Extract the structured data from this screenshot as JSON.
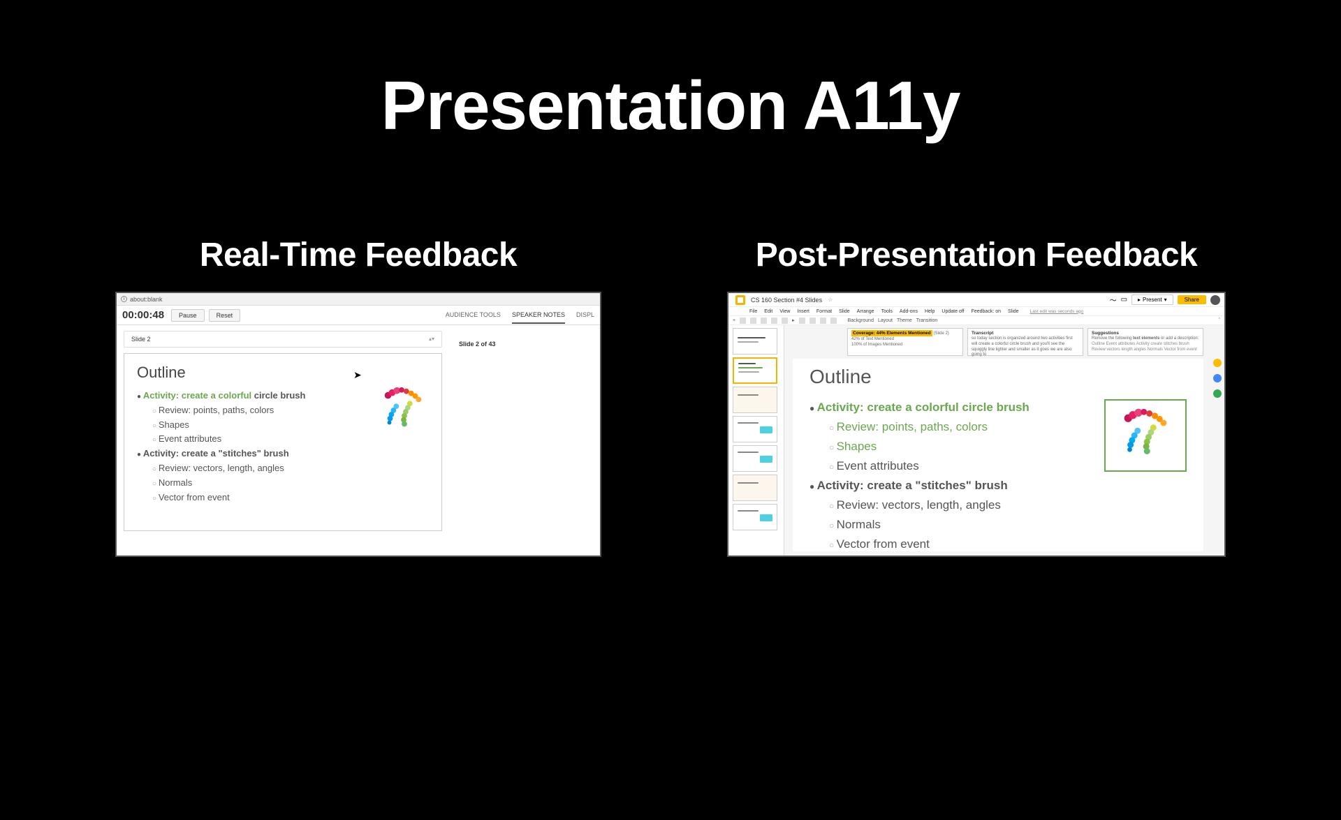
{
  "title": "Presentation A11y",
  "left": {
    "heading": "Real-Time Feedback",
    "url": "about:blank",
    "timer": "00:00:48",
    "pause": "Pause",
    "reset": "Reset",
    "tabs": {
      "audience": "AUDIENCE TOOLS",
      "speaker": "SPEAKER NOTES",
      "display": "DISPL"
    },
    "slide_sel": "Slide 2",
    "slide_of": "Slide 2 of 43",
    "outline": {
      "title": "Outline",
      "a1_hl": "Activity: create a colorful",
      "a1_rest": " circle brush",
      "s1": "Review: points, paths, colors",
      "s2": "Shapes",
      "s3": "Event attributes",
      "a2": "Activity: create a \"stitches\" brush",
      "s4": "Review: vectors, length, angles",
      "s5": "Normals",
      "s6": "Vector from event"
    }
  },
  "right": {
    "heading": "Post-Presentation Feedback",
    "doc_title": "CS 160 Section #4 Slides",
    "menus": [
      "File",
      "Edit",
      "View",
      "Insert",
      "Format",
      "Slide",
      "Arrange",
      "Tools",
      "Add-ons",
      "Help",
      "Update off",
      "Feedback: on",
      "Slide"
    ],
    "last_edit": "Last edit was seconds ago",
    "present": "Present",
    "share": "Share",
    "toolbar_labels": [
      "Background",
      "Layout",
      "Theme",
      "Transition"
    ],
    "coverage": {
      "head": "Coverage: 44% Elements Mentioned",
      "slide": "(Slide 2)",
      "l1": "42% of Text Mentioned",
      "l2": "100% of Images Mentioned"
    },
    "transcript": {
      "head": "Transcript",
      "body": "so today section is organized around two activities first will create a colorful circle brush and you'll see the squiggly line lighter and smaller as it goes we are also going to"
    },
    "suggest": {
      "head": "Suggestions",
      "b1": "Remove the following ",
      "b1b": "text elements",
      "b2": " or add a description: ",
      "b3": "Outline Event attributes Activity create stitches brush Review vectors length angles Normals Vector from event"
    },
    "outline2": {
      "title": "Outline",
      "a1": "Activity: create a colorful circle brush",
      "s1": "Review: points, paths, colors",
      "s2": "Shapes",
      "s3": "Event attributes",
      "a2": "Activity: create a \"stitches\" brush",
      "s4": "Review: vectors, length, angles",
      "s5": "Normals",
      "s6": "Vector from event"
    }
  }
}
